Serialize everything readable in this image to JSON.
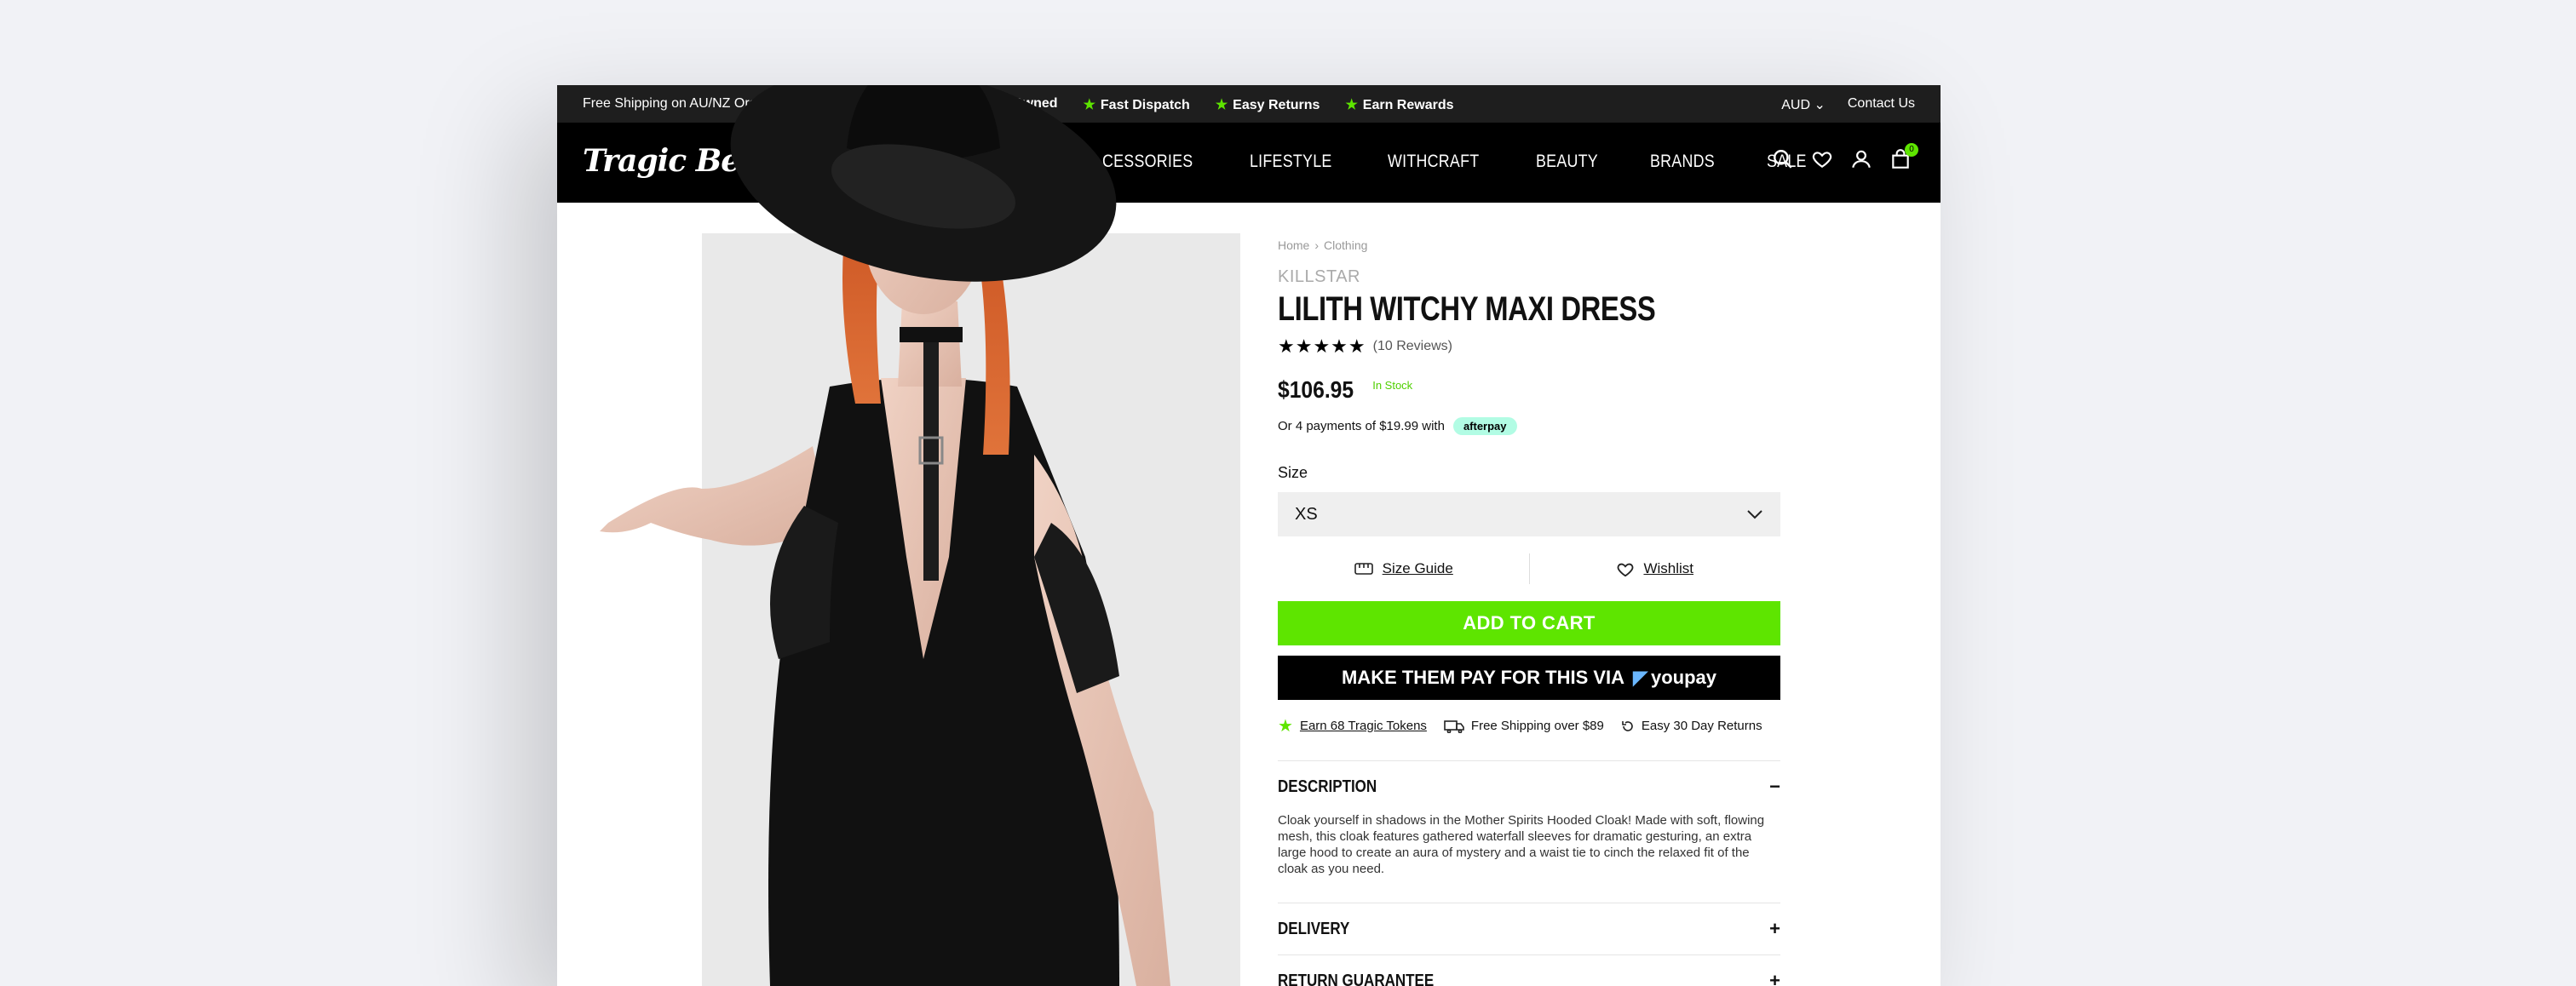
{
  "announcement": {
    "shipping": "Free Shipping on AU/NZ Orders $89+",
    "perks": [
      "n Owned",
      "Fast Dispatch",
      "Easy Returns",
      "Earn Rewards"
    ],
    "currency": "AUD",
    "contact": "Contact Us"
  },
  "nav": {
    "logo": "Tragic Beautiful",
    "items": [
      "CESSORIES",
      "LIFESTYLE",
      "WITHCRAFT",
      "BEAUTY",
      "BRANDS",
      "SALE"
    ],
    "cart_count": "0",
    "icons": [
      "search-icon",
      "heart-icon",
      "user-icon",
      "bag-icon"
    ]
  },
  "product": {
    "breadcrumb": [
      "Home",
      "Clothing"
    ],
    "brand": "KILLSTAR",
    "title": "LILITH WITCHY MAXI DRESS",
    "stars": "★★★★★",
    "reviews": "(10 Reviews)",
    "price": "$106.95",
    "stock": "In Stock",
    "afterpay_text": "Or 4 payments of $19.99 with",
    "afterpay_brand": "afterpay",
    "size_label": "Size",
    "size_value": "XS",
    "size_guide": "Size Guide",
    "wishlist": "Wishlist",
    "add_to_cart": "ADD TO CART",
    "youpay_label": "MAKE THEM PAY FOR THIS VIA",
    "youpay_brand": "youpay",
    "perks": {
      "tokens": "Earn 68 Tragic Tokens",
      "shipping": "Free Shipping over $89",
      "returns": "Easy 30 Day Returns"
    },
    "accordion": {
      "description_title": "DESCRIPTION",
      "description_body": "Cloak yourself in shadows in the Mother Spirits Hooded Cloak! Made with soft, flowing mesh, this cloak features gathered waterfall sleeves for dramatic gesturing, an extra large hood to create an aura of mystery and a waist tie to cinch the relaxed fit of the cloak as you need.",
      "delivery_title": "DELIVERY",
      "return_title": "RETURN GUARANTEE"
    }
  },
  "colors": {
    "accent_green": "#5ee500",
    "nav_bg": "#000000",
    "announcement_bg": "#1e1e1e",
    "afterpay_mint": "#b2fce4"
  }
}
